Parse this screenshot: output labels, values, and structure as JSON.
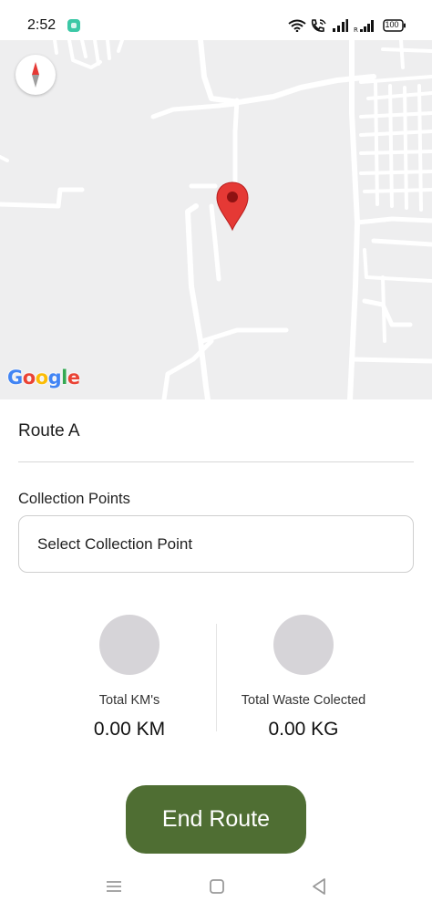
{
  "status_bar": {
    "time": "2:52",
    "battery": "100"
  },
  "map": {
    "logo_letters": [
      "G",
      "o",
      "o",
      "g",
      "l",
      "e"
    ],
    "logo_colors": [
      "#4285F4",
      "#EA4335",
      "#FBBC05",
      "#4285F4",
      "#34A853",
      "#EA4335"
    ],
    "pin_color": "#e53935"
  },
  "route": {
    "title": "Route A"
  },
  "collection": {
    "label": "Collection Points",
    "placeholder": "Select Collection Point"
  },
  "stats": {
    "distance": {
      "label": "Total KM's",
      "value": "0.00 KM"
    },
    "waste": {
      "label": "Total Waste Colected",
      "value": "0.00 KG"
    }
  },
  "actions": {
    "end_route": "End Route"
  },
  "colors": {
    "accent": "#4f6e33",
    "placeholder_circle": "#d6d4d8"
  }
}
